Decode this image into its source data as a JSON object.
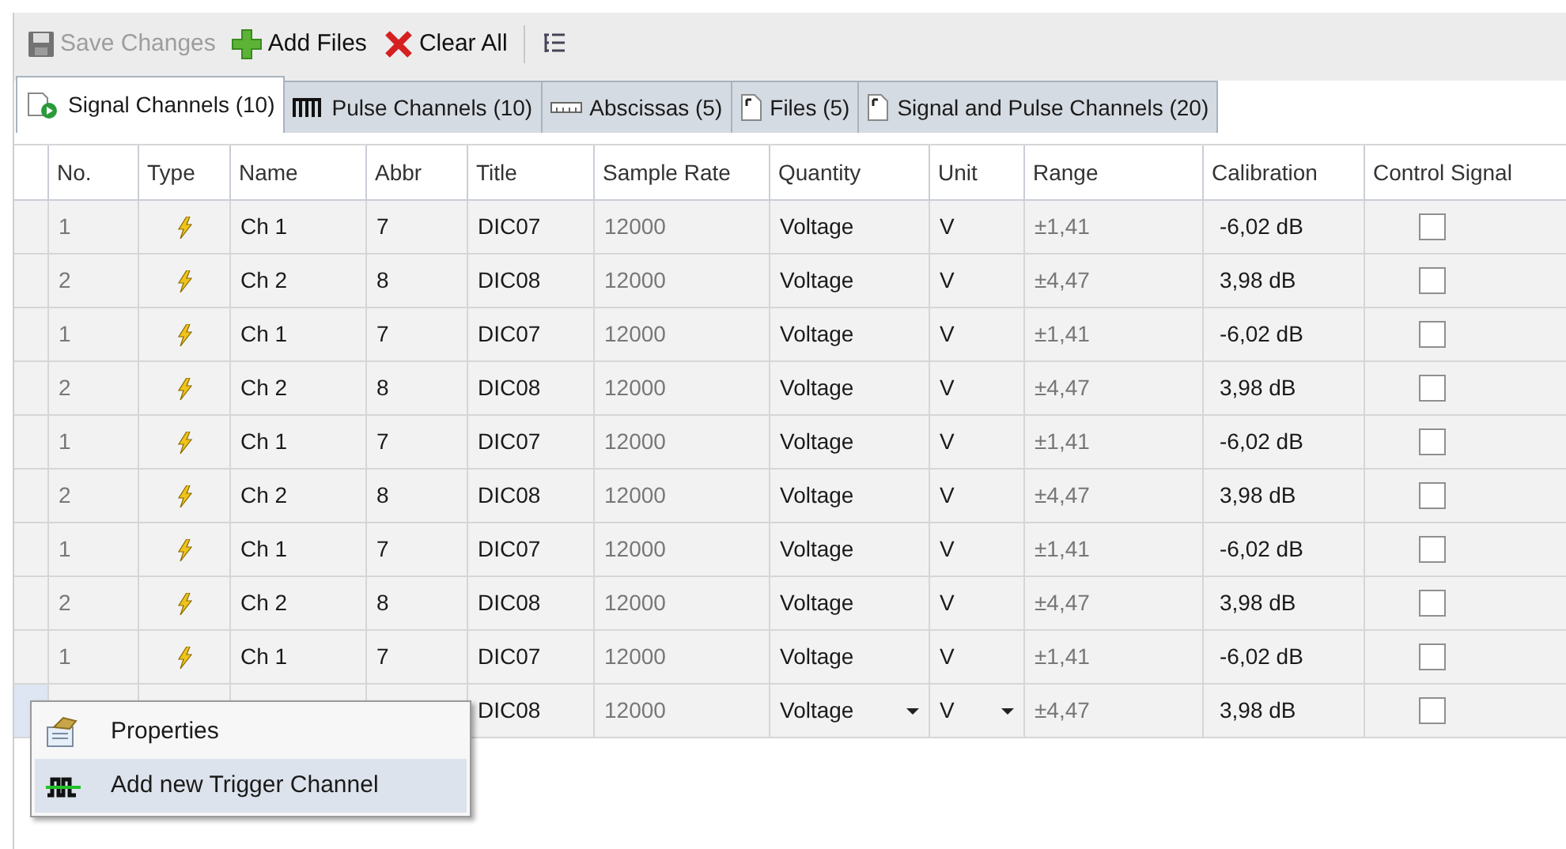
{
  "toolbar": [
    {
      "kind": "save",
      "label": "Save Changes",
      "disabled": true
    },
    {
      "kind": "add",
      "label": "Add Files",
      "disabled": false
    },
    {
      "kind": "clear",
      "label": "Clear All",
      "disabled": false
    },
    {
      "kind": "tree",
      "disabled": false
    }
  ],
  "tabs": [
    {
      "kind": "signal",
      "label": "Signal Channels (10)",
      "selected": true
    },
    {
      "kind": "pulse",
      "label": "Pulse Channels (10)",
      "selected": false
    },
    {
      "kind": "ruler",
      "label": "Abscissas (5)",
      "selected": false
    },
    {
      "kind": "file",
      "label": "Files (5)",
      "selected": false
    },
    {
      "kind": "file",
      "label": "Signal and Pulse Channels (20)",
      "selected": false
    }
  ],
  "table": {
    "columns": [
      "No.",
      "Type",
      "Name",
      "Abbr",
      "Title",
      "Sample Rate",
      "Quantity",
      "Unit",
      "Range",
      "Calibration",
      "Control Signal"
    ],
    "rows": [
      {
        "no": "1",
        "name": "Ch 1",
        "abbr": "7",
        "title": "DIC07",
        "rate": "12000",
        "quantity": "Voltage",
        "unit": "V",
        "range": "±1,41",
        "calibration": "-6,02 dB",
        "control_signal": false,
        "editing": false
      },
      {
        "no": "2",
        "name": "Ch 2",
        "abbr": "8",
        "title": "DIC08",
        "rate": "12000",
        "quantity": "Voltage",
        "unit": "V",
        "range": "±4,47",
        "calibration": "3,98 dB",
        "control_signal": false,
        "editing": false
      },
      {
        "no": "1",
        "name": "Ch 1",
        "abbr": "7",
        "title": "DIC07",
        "rate": "12000",
        "quantity": "Voltage",
        "unit": "V",
        "range": "±1,41",
        "calibration": "-6,02 dB",
        "control_signal": false,
        "editing": false
      },
      {
        "no": "2",
        "name": "Ch 2",
        "abbr": "8",
        "title": "DIC08",
        "rate": "12000",
        "quantity": "Voltage",
        "unit": "V",
        "range": "±4,47",
        "calibration": "3,98 dB",
        "control_signal": false,
        "editing": false
      },
      {
        "no": "1",
        "name": "Ch 1",
        "abbr": "7",
        "title": "DIC07",
        "rate": "12000",
        "quantity": "Voltage",
        "unit": "V",
        "range": "±1,41",
        "calibration": "-6,02 dB",
        "control_signal": false,
        "editing": false
      },
      {
        "no": "2",
        "name": "Ch 2",
        "abbr": "8",
        "title": "DIC08",
        "rate": "12000",
        "quantity": "Voltage",
        "unit": "V",
        "range": "±4,47",
        "calibration": "3,98 dB",
        "control_signal": false,
        "editing": false
      },
      {
        "no": "1",
        "name": "Ch 1",
        "abbr": "7",
        "title": "DIC07",
        "rate": "12000",
        "quantity": "Voltage",
        "unit": "V",
        "range": "±1,41",
        "calibration": "-6,02 dB",
        "control_signal": false,
        "editing": false
      },
      {
        "no": "2",
        "name": "Ch 2",
        "abbr": "8",
        "title": "DIC08",
        "rate": "12000",
        "quantity": "Voltage",
        "unit": "V",
        "range": "±4,47",
        "calibration": "3,98 dB",
        "control_signal": false,
        "editing": false
      },
      {
        "no": "1",
        "name": "Ch 1",
        "abbr": "7",
        "title": "DIC07",
        "rate": "12000",
        "quantity": "Voltage",
        "unit": "V",
        "range": "±1,41",
        "calibration": "-6,02 dB",
        "control_signal": false,
        "editing": false
      },
      {
        "title": "DIC08",
        "rate": "12000",
        "quantity": "Voltage",
        "unit": "V",
        "range": "±4,47",
        "calibration": "3,98 dB",
        "control_signal": false,
        "editing": true
      }
    ]
  },
  "context_menu": [
    {
      "kind": "properties",
      "label": "Properties",
      "selected": false
    },
    {
      "kind": "trigger",
      "label": "Add new Trigger Channel",
      "selected": true
    }
  ]
}
